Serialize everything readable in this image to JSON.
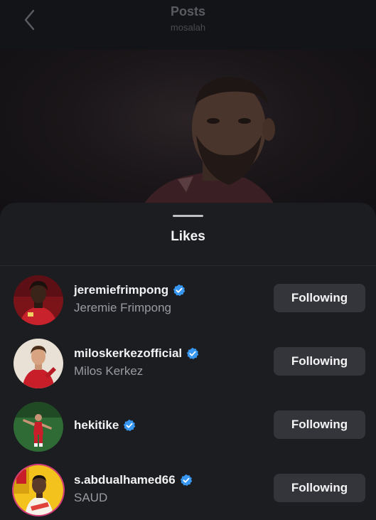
{
  "header": {
    "title": "Posts",
    "subtitle": "mosalah"
  },
  "sheet": {
    "title": "Likes"
  },
  "likes": [
    {
      "username": "jeremiefrimpong",
      "full_name": "Jeremie Frimpong",
      "verified": true,
      "button_label": "Following"
    },
    {
      "username": "miloskerkezofficial",
      "full_name": "Milos Kerkez",
      "verified": true,
      "button_label": "Following"
    },
    {
      "username": "hekitike",
      "full_name": "",
      "verified": true,
      "button_label": "Following"
    },
    {
      "username": "s.abdualhamed66",
      "full_name": "SAUD",
      "verified": true,
      "button_label": "Following"
    }
  ],
  "colors": {
    "verified_badge": "#3897f0",
    "sheet_background": "#1c1d21",
    "button_background": "#34353b"
  },
  "icons": [
    "chevron-left-icon",
    "verified-badge-icon"
  ]
}
